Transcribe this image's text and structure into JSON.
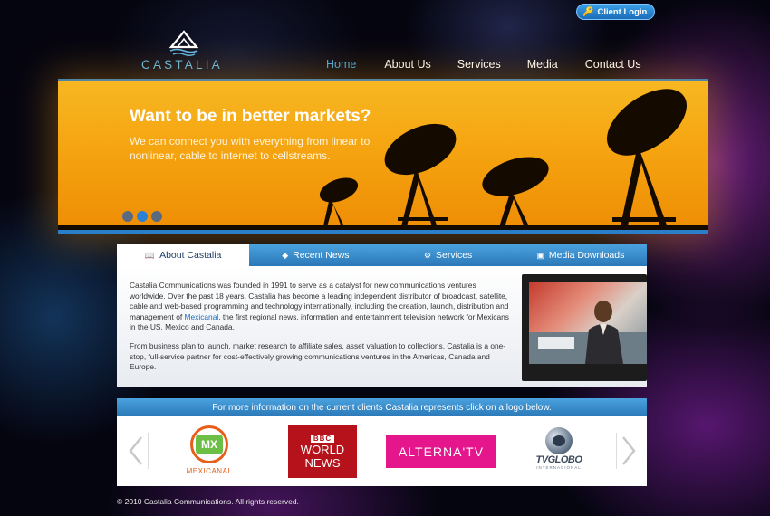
{
  "header": {
    "client_login": "Client Login",
    "logo_text": "CASTALIA"
  },
  "nav": {
    "items": [
      "Home",
      "About Us",
      "Services",
      "Media",
      "Contact Us"
    ],
    "active_color": "#3ea8e6"
  },
  "banner": {
    "headline": "Want to be in better markets?",
    "subline": "We can connect you with everything from linear to nonlinear, cable to internet to cellstreams.",
    "slides": 3,
    "active_slide": 2
  },
  "tabs": {
    "items": [
      {
        "label": "About Castalia",
        "icon": "book-icon",
        "active": true
      },
      {
        "label": "Recent News",
        "icon": "news-icon",
        "active": false
      },
      {
        "label": "Services",
        "icon": "gear-icon",
        "active": false
      },
      {
        "label": "Media Downloads",
        "icon": "monitor-icon",
        "active": false
      }
    ]
  },
  "about": {
    "p1_before": "Castalia Communications was founded in 1991 to serve as a catalyst for new communications ventures worldwide. Over the past 18 years, Castalia has become a leading independent distributor of broadcast, satellite, cable and web-based programming and technology internationally, including the creation, launch, distribution and management of ",
    "p1_link": "Mexicanal",
    "p1_after": ", the first regional news, information and entertainment television network for Mexicans in the US, Mexico and Canada.",
    "p2": "From business plan to launch, market research to affiliate sales, asset valuation to collections, Castalia is a one-stop, full-service partner for cost-effectively growing communications ventures in the Americas, Canada and Europe."
  },
  "clients": {
    "heading": "For more information on the current clients Castalia represents click on a logo below.",
    "logos": [
      {
        "name": "mexicanal",
        "mark": "MX",
        "text": "MEXICANAL",
        "color": "#e85d1a"
      },
      {
        "name": "bbc-world-news",
        "line1": "BBC",
        "line2": "WORLD",
        "line3": "NEWS",
        "color": "#b5121b"
      },
      {
        "name": "alterna-tv",
        "text": "ALTERNA'TV",
        "color": "#e5168b"
      },
      {
        "name": "tv-globo",
        "text": "TVGLOBO",
        "sub": "INTERNACIONAL"
      }
    ]
  },
  "footer": {
    "text": "© 2010 Castalia Communications. All rights reserved."
  }
}
